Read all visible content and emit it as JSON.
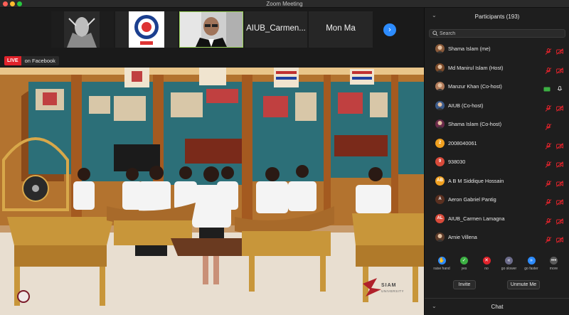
{
  "window": {
    "title": "Zoom Meeting"
  },
  "thumbnails": [
    {
      "label": ""
    },
    {
      "label": ""
    },
    {
      "label": ""
    },
    {
      "label": "AIUB_Carmen..."
    },
    {
      "label": "Mon Ma"
    }
  ],
  "live": {
    "badge": "LIVE",
    "destination": "on Facebook"
  },
  "watermark": {
    "name": "SIAM",
    "sub": "UNIVERSITY"
  },
  "panel": {
    "title": "Participants (193)",
    "search_placeholder": "Search",
    "participants": [
      {
        "name": "Shama Islam (me)",
        "avatar": "photo",
        "mic": "muted",
        "video": "off"
      },
      {
        "name": "Md Manirul Islam (Host)",
        "avatar": "photo",
        "mic": "muted",
        "video": "off"
      },
      {
        "name": "Manzur Khan (Co-host)",
        "avatar": "photo",
        "mic": "on",
        "video": "on"
      },
      {
        "name": "AIUB (Co-host)",
        "avatar": "photo",
        "mic": "muted",
        "video": "off"
      },
      {
        "name": "Shama Islam (Co-host)",
        "avatar": "photo",
        "mic": "muted",
        "video": "none"
      },
      {
        "name": "2008040061",
        "avatar": "2",
        "avatar_color": "#f0a020",
        "mic": "muted",
        "video": "off"
      },
      {
        "name": "938030",
        "avatar": "9",
        "avatar_color": "#d84a3a",
        "mic": "muted",
        "video": "off"
      },
      {
        "name": "A B M Siddique Hossain",
        "avatar": "AB",
        "avatar_color": "#f0a020",
        "mic": "muted",
        "video": "off"
      },
      {
        "name": "Aeron Gabriel Pantig",
        "avatar": "A",
        "avatar_color": "#5a3020",
        "mic": "muted",
        "video": "off"
      },
      {
        "name": "AIUB_Carmen Lamagna",
        "avatar": "AL",
        "avatar_color": "#d84a3a",
        "mic": "muted",
        "video": "off"
      },
      {
        "name": "Arnie Villena",
        "avatar": "photo",
        "mic": "muted",
        "video": "off"
      }
    ],
    "controls": [
      {
        "label": "raise hand",
        "color": "#2d8cff",
        "glyph": "✋"
      },
      {
        "label": "yes",
        "color": "#3cb043",
        "glyph": "✓"
      },
      {
        "label": "no",
        "color": "#e0232b",
        "glyph": "✕"
      },
      {
        "label": "go slower",
        "color": "#6b6b8a",
        "glyph": "«"
      },
      {
        "label": "go faster",
        "color": "#2d8cff",
        "glyph": "»"
      },
      {
        "label": "more",
        "color": "#5a5a5a",
        "glyph": "•••"
      }
    ],
    "invite_label": "Invite",
    "unmute_label": "Unmute Me",
    "chat_title": "Chat"
  },
  "colors": {
    "accent": "#2d8cff",
    "muted": "#e0232b",
    "live": "#e0232b"
  }
}
